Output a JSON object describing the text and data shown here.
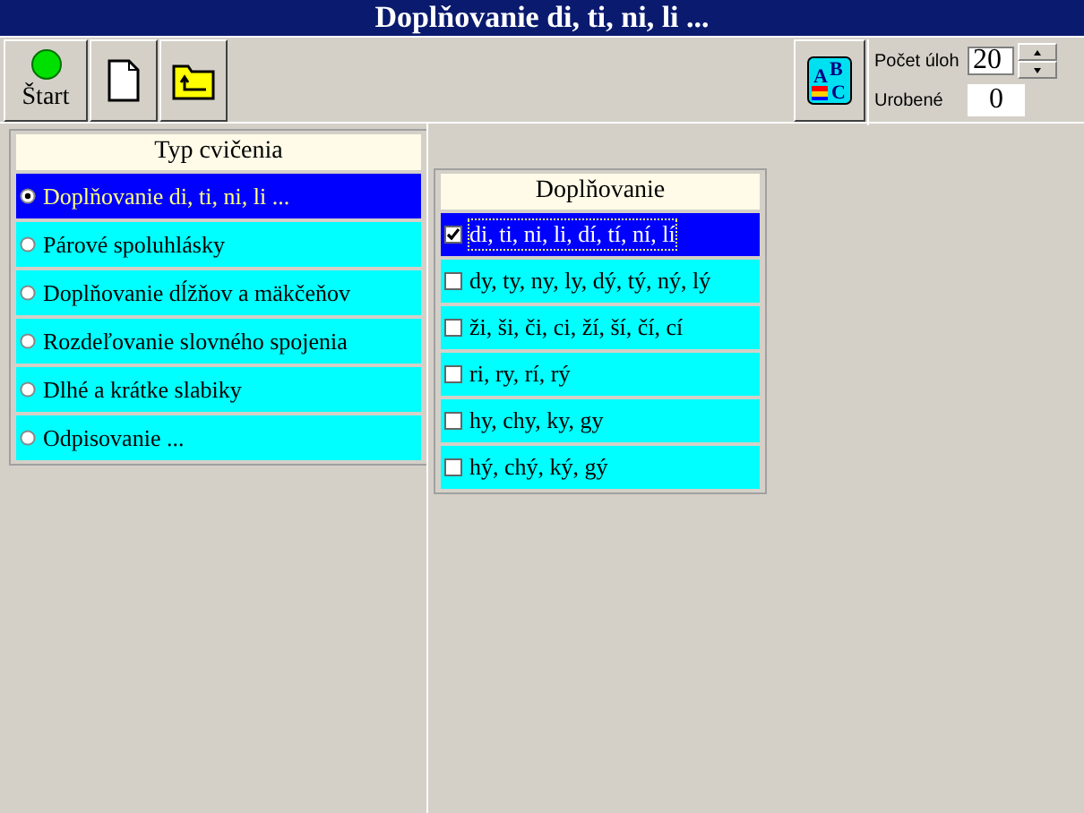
{
  "window": {
    "title": "Doplňovanie di, ti, ni, li ..."
  },
  "toolbar": {
    "start_label": "Štart",
    "spelling_icon_letters": [
      "A",
      "B",
      "C"
    ],
    "count_label": "Počet úloh",
    "count_value": "20",
    "done_label": "Urobené",
    "done_value": "0"
  },
  "exercise_types": {
    "header": "Typ cvičenia",
    "items": [
      {
        "label": "Doplňovanie di, ti, ni, li ...",
        "selected": true
      },
      {
        "label": "Párové spoluhlásky",
        "selected": false
      },
      {
        "label": "Doplňovanie dĺžňov a mäkčeňov",
        "selected": false
      },
      {
        "label": "Rozdeľovanie slovného spojenia",
        "selected": false
      },
      {
        "label": "Dlhé a krátke slabiky",
        "selected": false
      },
      {
        "label": "Odpisovanie ...",
        "selected": false
      }
    ]
  },
  "options": {
    "header": "Doplňovanie",
    "items": [
      {
        "label": "di, ti, ni, li, dí, tí, ní, lí",
        "checked": true,
        "selected": true
      },
      {
        "label": "dy, ty, ny, ly, dý, tý, ný, lý",
        "checked": false,
        "selected": false
      },
      {
        "label": "ži, ši, či, ci, ží, ší, čí, cí",
        "checked": false,
        "selected": false
      },
      {
        "label": "ri, ry, rí, rý",
        "checked": false,
        "selected": false
      },
      {
        "label": "hy, chy, ky, gy",
        "checked": false,
        "selected": false
      },
      {
        "label": "hý, chý, ký, gý",
        "checked": false,
        "selected": false
      }
    ]
  }
}
